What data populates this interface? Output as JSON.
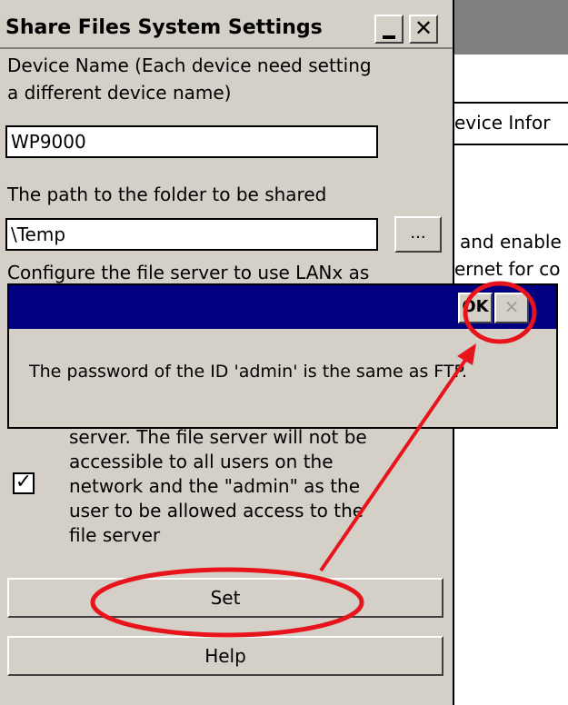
{
  "background_window": {
    "tab_label": "evice Infor",
    "text_line1": "and enable",
    "text_line2": "ernet for co"
  },
  "settings_window": {
    "title": "Share Files System Settings",
    "minimize_glyph": "_",
    "close_glyph": "✕",
    "device_name_label_line1": "Device Name (Each device need setting",
    "device_name_label_line2": "a different device name)",
    "device_name_value": "WP9000",
    "path_label": "The path to the folder to be shared",
    "path_value": "\\Temp",
    "browse_label": "...",
    "configure_label": "Configure the file server to use LANx as",
    "checkbox_checked": true,
    "checkbox_glyph": "✓",
    "description_lines": [
      "server. The file server will not be",
      "accessible to all users on the",
      "network and the \"admin\" as the",
      "user to be allowed access to the",
      "file server"
    ],
    "set_button": "Set",
    "help_button": "Help"
  },
  "dialog": {
    "ok_label": "OK",
    "close_glyph": "✕",
    "message": "The password of the ID 'admin' is the same as FTP."
  },
  "annotation": {
    "color": "#e8141c"
  }
}
